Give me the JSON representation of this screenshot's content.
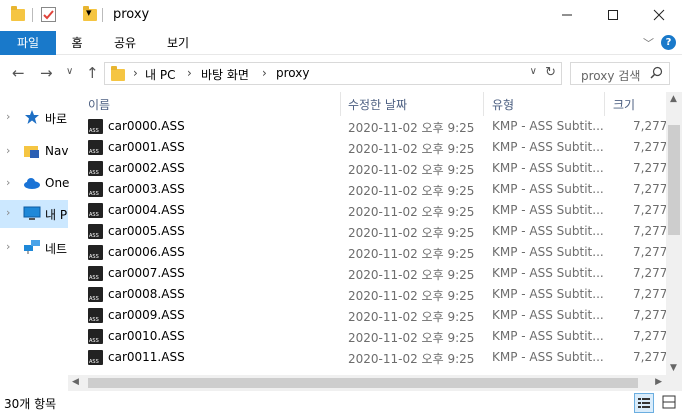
{
  "window": {
    "title": "proxy",
    "minimize_icon": "minimize-icon",
    "maximize_icon": "maximize-icon",
    "close_icon": "close-icon"
  },
  "ribbon": {
    "tabs": [
      "파일",
      "홈",
      "공유",
      "보기"
    ],
    "accent": "#1979ca"
  },
  "address": {
    "breadcrumbs": [
      "내 PC",
      "바탕 화면",
      "proxy"
    ]
  },
  "search": {
    "placeholder": "proxy 검색"
  },
  "sidebar": {
    "items": [
      {
        "label": "바로",
        "icon": "star-icon",
        "selected": false
      },
      {
        "label": "Nav",
        "icon": "nav-folder-icon",
        "selected": false
      },
      {
        "label": "One",
        "icon": "cloud-icon",
        "selected": false
      },
      {
        "label": "내 P",
        "icon": "computer-icon",
        "selected": true
      },
      {
        "label": "네트",
        "icon": "network-icon",
        "selected": false
      }
    ]
  },
  "columns": {
    "name": "이름",
    "date": "수정한 날짜",
    "type": "유형",
    "size": "크기"
  },
  "files": [
    {
      "name": "car0000.ASS",
      "date": "2020-11-02 오후 9:25",
      "type": "KMP - ASS Subtit...",
      "size": "7,277"
    },
    {
      "name": "car0001.ASS",
      "date": "2020-11-02 오후 9:25",
      "type": "KMP - ASS Subtit...",
      "size": "7,277"
    },
    {
      "name": "car0002.ASS",
      "date": "2020-11-02 오후 9:25",
      "type": "KMP - ASS Subtit...",
      "size": "7,277"
    },
    {
      "name": "car0003.ASS",
      "date": "2020-11-02 오후 9:25",
      "type": "KMP - ASS Subtit...",
      "size": "7,277"
    },
    {
      "name": "car0004.ASS",
      "date": "2020-11-02 오후 9:25",
      "type": "KMP - ASS Subtit...",
      "size": "7,277"
    },
    {
      "name": "car0005.ASS",
      "date": "2020-11-02 오후 9:25",
      "type": "KMP - ASS Subtit...",
      "size": "7,277"
    },
    {
      "name": "car0006.ASS",
      "date": "2020-11-02 오후 9:25",
      "type": "KMP - ASS Subtit...",
      "size": "7,277"
    },
    {
      "name": "car0007.ASS",
      "date": "2020-11-02 오후 9:25",
      "type": "KMP - ASS Subtit...",
      "size": "7,277"
    },
    {
      "name": "car0008.ASS",
      "date": "2020-11-02 오후 9:25",
      "type": "KMP - ASS Subtit...",
      "size": "7,277"
    },
    {
      "name": "car0009.ASS",
      "date": "2020-11-02 오후 9:25",
      "type": "KMP - ASS Subtit...",
      "size": "7,277"
    },
    {
      "name": "car0010.ASS",
      "date": "2020-11-02 오후 9:25",
      "type": "KMP - ASS Subtit...",
      "size": "7,277"
    },
    {
      "name": "car0011.ASS",
      "date": "2020-11-02 오후 9:25",
      "type": "KMP - ASS Subtit...",
      "size": "7,277"
    }
  ],
  "status": {
    "count": "30개 항목"
  }
}
